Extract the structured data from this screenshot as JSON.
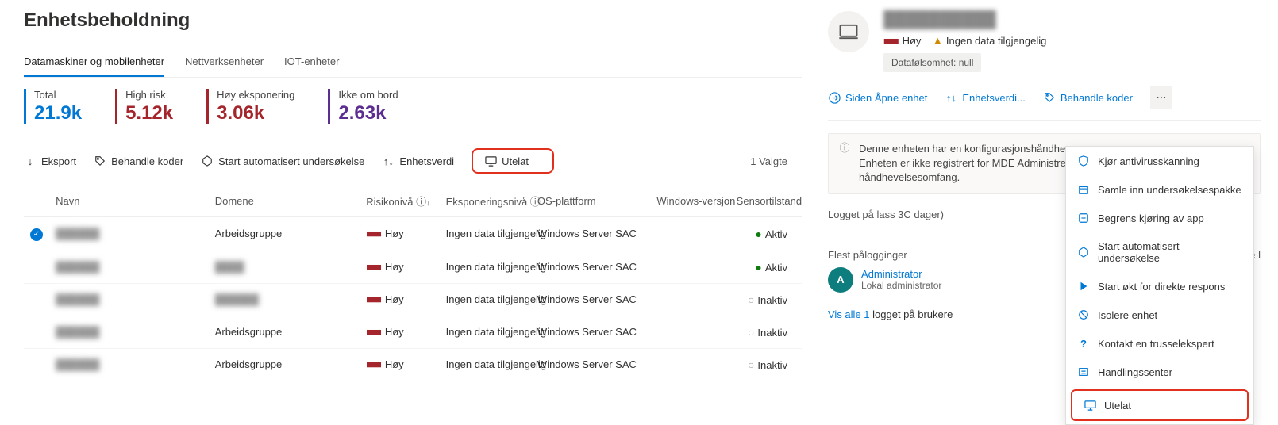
{
  "page": {
    "title": "Enhetsbeholdning"
  },
  "tabs": [
    {
      "label": "Datamaskiner og mobilenheter",
      "active": true
    },
    {
      "label": "Nettverksenheter",
      "active": false
    },
    {
      "label": "IOT-enheter",
      "active": false
    }
  ],
  "kpis": [
    {
      "label": "Total",
      "value": "21.9k",
      "color": "#0078d4"
    },
    {
      "label": "High risk",
      "value": "5.12k",
      "color": "#a4262c"
    },
    {
      "label": "Høy eksponering",
      "value": "3.06k",
      "color": "#a4262c"
    },
    {
      "label": "Ikke om bord",
      "value": "2.63k",
      "color": "#5c2e91"
    }
  ],
  "toolbar": {
    "export": "Eksport",
    "manage_tags": "Behandle koder",
    "start_investigation": "Start automatisert undersøkelse",
    "device_value": "Enhetsverdi",
    "exclude": "Utelat",
    "selected": "1 Valgte"
  },
  "table": {
    "selected_row": 0,
    "headers": {
      "name": "Navn",
      "domain": "Domene",
      "risk": "Risikonivå ⓘ",
      "exposure": "Eksponeringsnivå ⓘ",
      "os": "OS-plattform",
      "windows": "Windows-versjon",
      "sensor": "Sensortilstand"
    },
    "rows": [
      {
        "name": "██████",
        "domain": "Arbeidsgruppe",
        "risk": "Høy",
        "exposure": "Ingen data tilgjengelig",
        "os": "Windows Server SAC",
        "windows": "",
        "sensor": "Aktiv",
        "active": true,
        "blur_domain": false
      },
      {
        "name": "██████",
        "domain": "████",
        "risk": "Høy",
        "exposure": "Ingen data tilgjengelig",
        "os": "Windows Server SAC",
        "windows": "",
        "sensor": "Aktiv",
        "active": true,
        "blur_domain": true
      },
      {
        "name": "██████",
        "domain": "██████",
        "risk": "Høy",
        "exposure": "Ingen data tilgjengelig",
        "os": "Windows Server SAC",
        "windows": "",
        "sensor": "Inaktiv",
        "active": false,
        "blur_domain": true
      },
      {
        "name": "██████",
        "domain": "Arbeidsgruppe",
        "risk": "Høy",
        "exposure": "Ingen data tilgjengelig",
        "os": "Windows Server SAC",
        "windows": "",
        "sensor": "Inaktiv",
        "active": false,
        "blur_domain": false
      },
      {
        "name": "██████",
        "domain": "Arbeidsgruppe",
        "risk": "Høy",
        "exposure": "Ingen data tilgjengelig",
        "os": "Windows Server SAC",
        "windows": "",
        "sensor": "Inaktiv",
        "active": false,
        "blur_domain": false
      }
    ]
  },
  "panel": {
    "device_name": "██████████",
    "risk_label": "Høy",
    "no_data": "Ingen data tilgjengelig",
    "sensitivity": "Datafølsomhet: null",
    "actions": {
      "open_device": "Siden Åpne enhet",
      "device_value": "Enhetsverdi...",
      "manage_tags": "Behandle koder"
    },
    "notice_line1": "Denne enheten har en konfigurasjonshåndhever",
    "notice_line2": "Enheten er ikke registrert for MDE Administrer meg med forutsetninger og håndhevelsesomfang.",
    "logged_on": "Logget på lass 3C dager)",
    "most_logins_label": "Flest pålogginger",
    "newest_label": "Nyeste l",
    "user_name": "Administrator",
    "user_role": "Lokal administrator",
    "avatar_initial": "A",
    "footer_count": "Vis alle 1",
    "footer_text": "logget på brukere"
  },
  "menu": [
    {
      "label": "Kjør antivirusskanning",
      "icon": "shield"
    },
    {
      "label": "Samle inn undersøkelsespakke",
      "icon": "package"
    },
    {
      "label": "Begrens kjøring av app",
      "icon": "restrict"
    },
    {
      "label": "Start automatisert undersøkelse",
      "icon": "hex"
    },
    {
      "label": "Start økt for direkte respons",
      "icon": "play"
    },
    {
      "label": "Isolere enhet",
      "icon": "block"
    },
    {
      "label": "Kontakt en trusselekspert",
      "icon": "help"
    },
    {
      "label": "Handlingssenter",
      "icon": "action"
    },
    {
      "label": "Utelat",
      "icon": "exclude",
      "highlight": true
    }
  ]
}
